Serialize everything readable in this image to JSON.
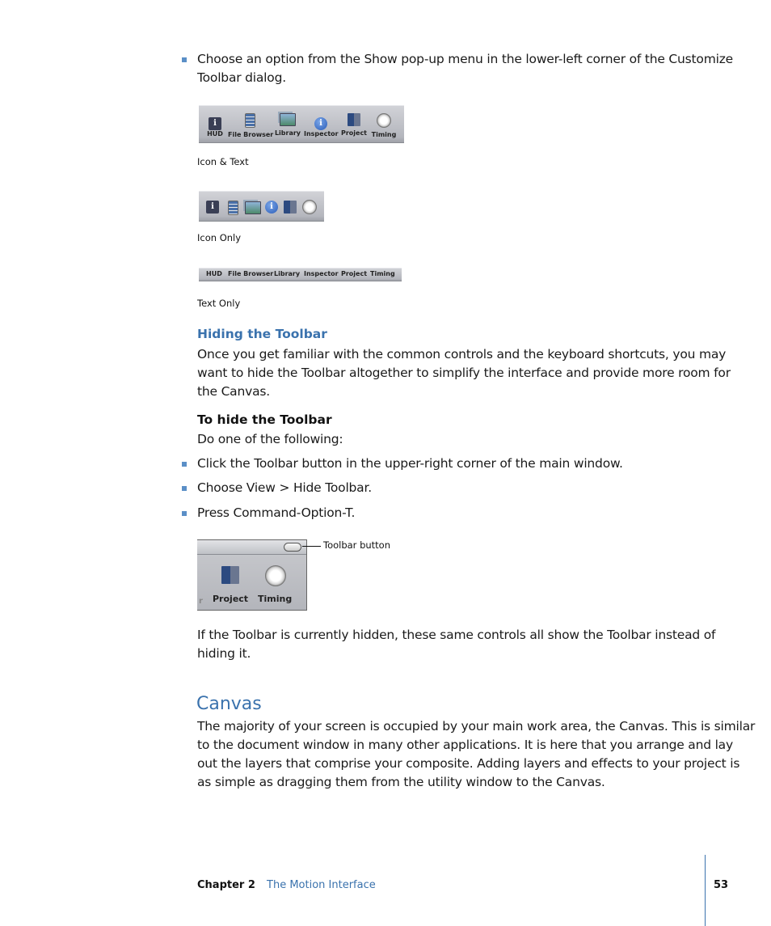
{
  "intro_bullet": "Choose an option from the Show pop-up menu in the lower-left corner of the Customize Toolbar dialog.",
  "intro_bullet_line1": "Choose an option from the Show pop-up menu in the lower-left corner of the Customize",
  "intro_bullet_line2": "Toolbar dialog.",
  "figures": {
    "icon_text": {
      "caption": "Icon & Text",
      "items": [
        {
          "label": "HUD",
          "icon": "hud-icon"
        },
        {
          "label": "File Browser",
          "icon": "file-browser-icon"
        },
        {
          "label": "Library",
          "icon": "library-icon"
        },
        {
          "label": "Inspector",
          "icon": "inspector-icon"
        },
        {
          "label": "Project",
          "icon": "project-icon"
        },
        {
          "label": "Timing",
          "icon": "timing-icon"
        }
      ]
    },
    "icon_only": {
      "caption": "Icon Only"
    },
    "text_only": {
      "caption": "Text Only"
    },
    "toolbar_button": {
      "callout": "Toolbar button",
      "items": [
        {
          "label": "Project",
          "icon": "project-icon"
        },
        {
          "label": "Timing",
          "icon": "timing-icon"
        }
      ],
      "partial_label": "r"
    }
  },
  "hiding": {
    "heading": "Hiding the Toolbar",
    "para_lines": [
      "Once you get familiar with the common controls and the keyboard shortcuts, you may",
      "want to hide the Toolbar altogether to simplify the interface and provide more room for",
      "the Canvas."
    ],
    "task_heading": "To hide the Toolbar",
    "task_intro": "Do one of the following:",
    "bullets": [
      "Click the Toolbar button in the upper-right corner of the main window.",
      "Choose View > Hide Toolbar.",
      "Press Command-Option-T."
    ],
    "after_lines": [
      "If the Toolbar is currently hidden, these same controls all show the Toolbar instead of",
      "hiding it."
    ]
  },
  "canvas": {
    "heading": "Canvas",
    "para_lines": [
      "The majority of your screen is occupied by your main work area, the Canvas. This is similar",
      "to the document window in many other applications. It is here that you arrange and lay",
      "out the layers that comprise your composite. Adding layers and effects to your project is",
      "as simple as dragging them from the utility window to the Canvas."
    ]
  },
  "footer": {
    "chapter": "Chapter 2",
    "chapter_title": "The Motion Interface",
    "page_number": "53"
  },
  "colors": {
    "accent": "#3a72ad",
    "bullet": "#5b8fc7"
  }
}
